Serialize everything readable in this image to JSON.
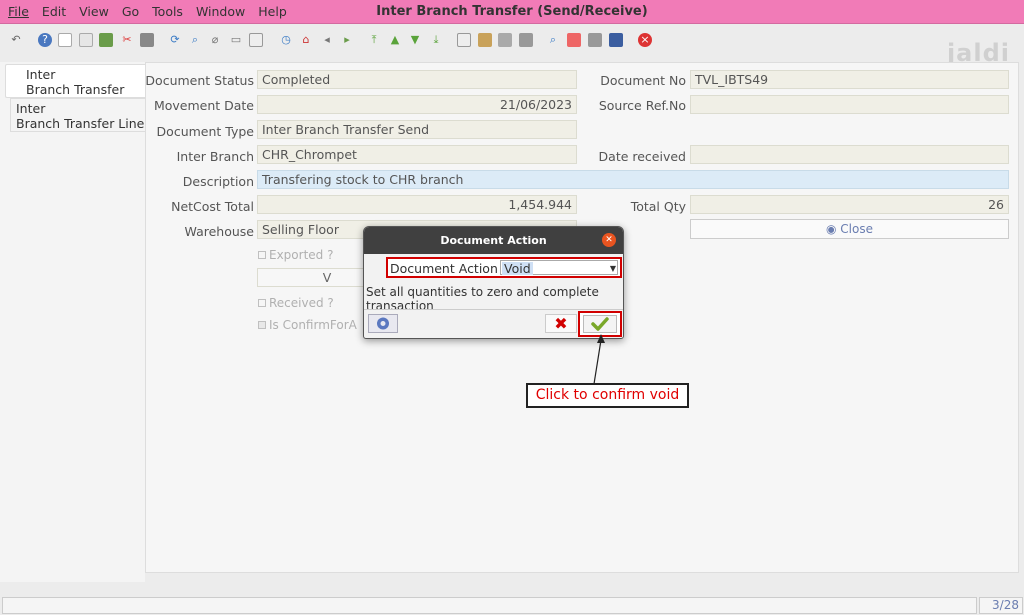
{
  "window": {
    "title": "Inter Branch Transfer (Send/Receive)"
  },
  "menu": [
    "File",
    "Edit",
    "View",
    "Go",
    "Tools",
    "Window",
    "Help"
  ],
  "watermark": "jaldi",
  "nav": {
    "tab1": [
      "Inter",
      "Branch Transfer"
    ],
    "tab2": [
      "Inter",
      "Branch Transfer Line"
    ]
  },
  "form": {
    "document_status": {
      "label": "Document Status",
      "value": "Completed"
    },
    "movement_date": {
      "label": "Movement Date",
      "value": "21/06/2023"
    },
    "document_type": {
      "label": "Document Type",
      "value": "Inter Branch Transfer Send"
    },
    "inter_branch": {
      "label": "Inter Branch",
      "value": "CHR_Chrompet"
    },
    "description": {
      "label": "Description",
      "value": "Transfering stock to CHR branch"
    },
    "netcost_total": {
      "label": "NetCost Total",
      "value": "1,454.944"
    },
    "warehouse": {
      "label": "Warehouse",
      "value": "Selling Floor"
    },
    "document_no": {
      "label": "Document No",
      "value": "TVL_IBTS49"
    },
    "source_ref": {
      "label": "Source Ref.No",
      "value": ""
    },
    "date_received": {
      "label": "Date received",
      "value": ""
    },
    "total_qty": {
      "label": "Total Qty",
      "value": "26"
    },
    "exported": "Exported ?",
    "v_button": "V",
    "received": "Received ?",
    "is_confirm": "Is ConfirmForA",
    "close_button": "Close"
  },
  "dialog": {
    "title": "Document Action",
    "field_label": "Document Action",
    "selected": "Void",
    "message": "Set all quantities to zero and complete transaction"
  },
  "callout": "Click to confirm void",
  "status": {
    "page": "3/28"
  },
  "colors": {
    "titlebar": "#f17bb7",
    "highlight": "#d10000",
    "field_bg": "#f0efe6"
  }
}
